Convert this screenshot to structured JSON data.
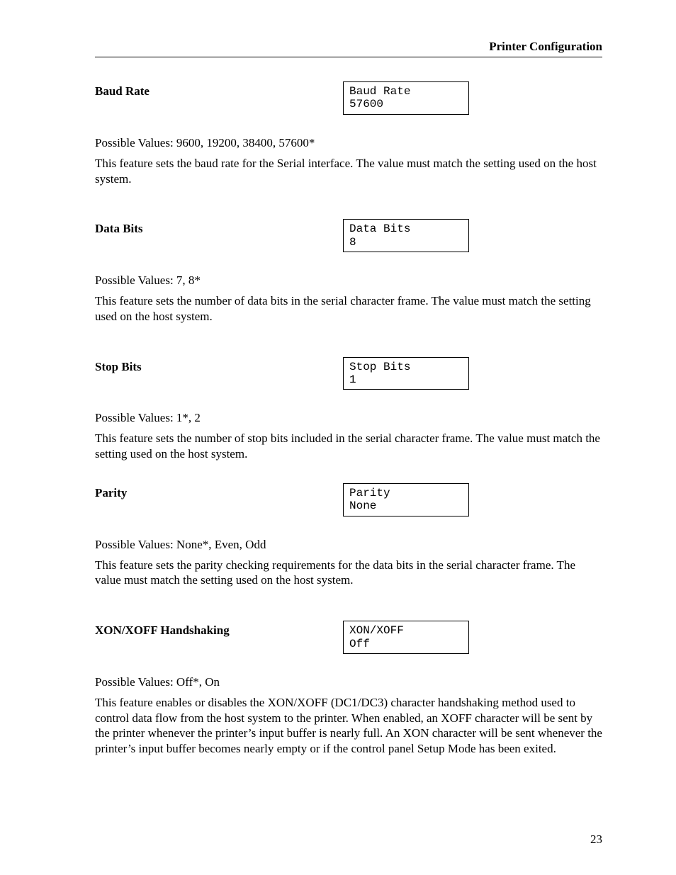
{
  "header": {
    "title": "Printer Configuration"
  },
  "sections": [
    {
      "label": "Baud Rate",
      "display_line1": "Baud Rate",
      "display_line2": "57600",
      "possible_values": "Possible Values:  9600, 19200, 38400, 57600*",
      "description": "This feature sets the baud rate for the Serial interface.  The value must match the setting used on the host system."
    },
    {
      "label": "Data Bits",
      "display_line1": "Data Bits",
      "display_line2": "8",
      "possible_values": "Possible Values:  7, 8*",
      "description": "This feature sets the number of data bits in the serial character frame.  The value must match the setting used on the host system."
    },
    {
      "label": "Stop Bits",
      "display_line1": "Stop Bits",
      "display_line2": "1",
      "possible_values": "Possible Values:  1*, 2",
      "description": "This feature sets the number of stop bits included in the serial character frame.  The value must match the setting used on the host system."
    },
    {
      "label": "Parity",
      "display_line1": "Parity",
      "display_line2": "None",
      "possible_values": "Possible Values:  None*, Even, Odd",
      "description": "This feature sets the parity checking requirements for the data bits in the serial character frame.  The value must match the setting used on the host system."
    },
    {
      "label": "XON/XOFF Handshaking",
      "display_line1": "XON/XOFF",
      "display_line2": "Off",
      "possible_values": "Possible Values:  Off*, On",
      "description": "This feature enables or disables the XON/XOFF (DC1/DC3) character handshaking method used to control data flow from the host system to the printer.  When enabled, an XOFF character will be sent by the printer whenever the printer’s input buffer is nearly full.  An XON character will be sent whenever the printer’s input buffer becomes nearly empty or if the control panel Setup Mode has been exited."
    }
  ],
  "page_number": "23"
}
